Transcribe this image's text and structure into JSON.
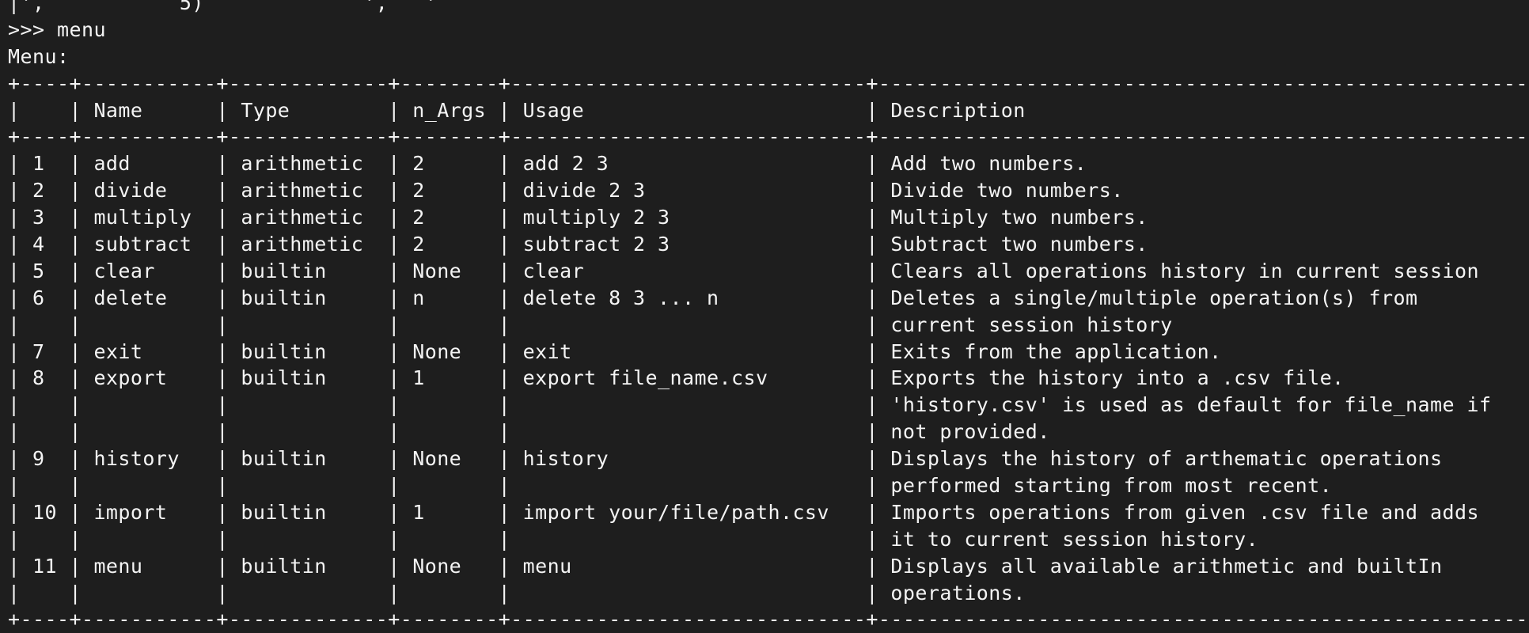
{
  "terminal": {
    "lines": [
      "|',           5)             ',   '",
      ">>> menu",
      "Menu:",
      "+----+-----------+-------------+--------+-----------------------------+-------------------------------------------------------+",
      "|    | Name      | Type        | n_Args | Usage                       | Description                                           |",
      "+----+-----------+-------------+--------+-----------------------------+-------------------------------------------------------+",
      "| 1  | add       | arithmetic  | 2      | add 2 3                     | Add two numbers.                                      |",
      "| 2  | divide    | arithmetic  | 2      | divide 2 3                  | Divide two numbers.                                   |",
      "| 3  | multiply  | arithmetic  | 2      | multiply 2 3                | Multiply two numbers.                                 |",
      "| 4  | subtract  | arithmetic  | 2      | subtract 2 3                | Subtract two numbers.                                 |",
      "| 5  | clear     | builtin     | None   | clear                       | Clears all operations history in current session      |",
      "| 6  | delete    | builtin     | n      | delete 8 3 ... n            | Deletes a single/multiple operation(s) from           |",
      "|    |           |             |        |                             | current session history                               |",
      "| 7  | exit      | builtin     | None   | exit                        | Exits from the application.                           |",
      "| 8  | export    | builtin     | 1      | export file_name.csv        | Exports the history into a .csv file.                 |",
      "|    |           |             |        |                             | 'history.csv' is used as default for file_name if     |",
      "|    |           |             |        |                             | not provided.                                         |",
      "| 9  | history   | builtin     | None   | history                     | Displays the history of arthematic operations         |",
      "|    |           |             |        |                             | performed starting from most recent.                  |",
      "| 10 | import    | builtin     | 1      | import your/file/path.csv   | Imports operations from given .csv file and adds      |",
      "|    |           |             |        |                             | it to current session history.                        |",
      "| 11 | menu      | builtin     | None   | menu                        | Displays all available arithmetic and builtIn         |",
      "|    |           |             |        |                             | operations.                                           |",
      "+----+-----------+-------------+--------+-----------------------------+-------------------------------------------------------+"
    ]
  },
  "colors": {
    "background": "#1e1e1e",
    "text": "#f4f4f4"
  }
}
